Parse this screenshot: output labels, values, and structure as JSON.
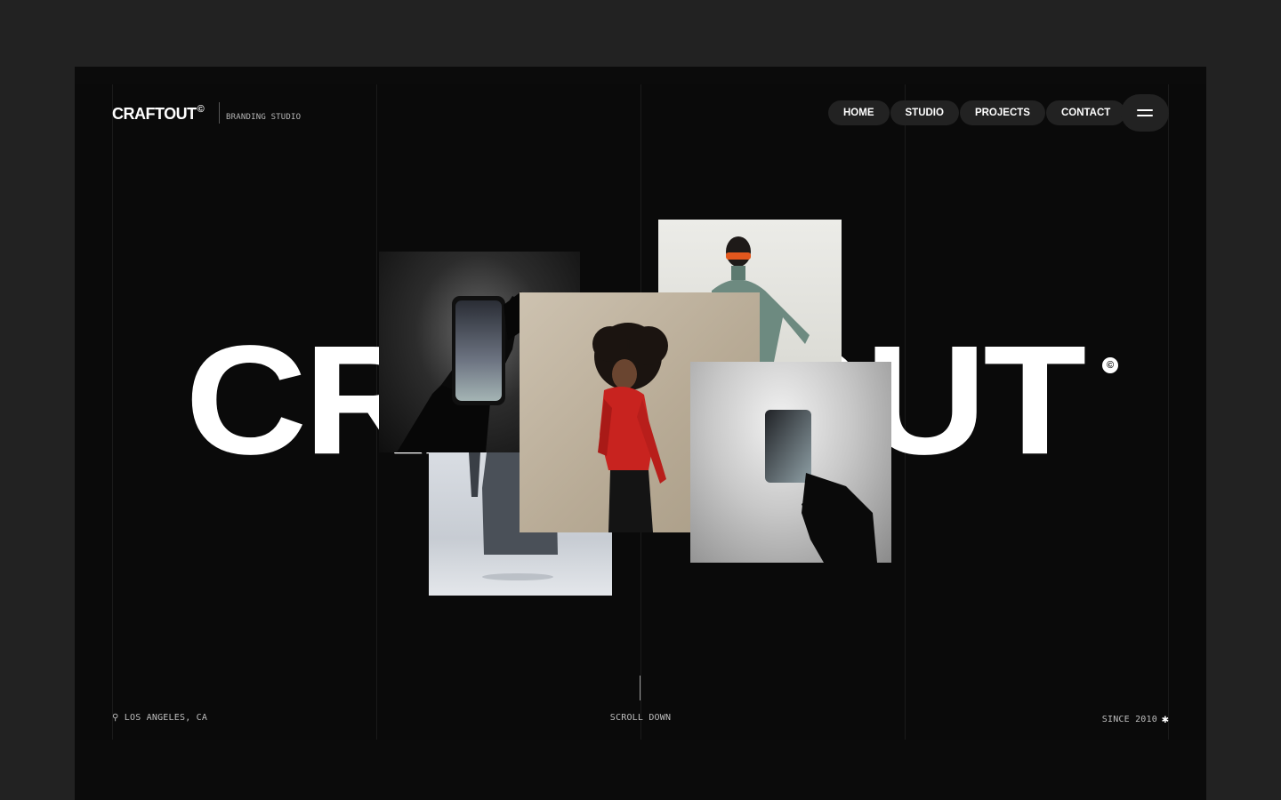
{
  "header": {
    "logo": "CRAFTOUT",
    "logo_mark": "©",
    "tagline": "BRANDING STUDIO"
  },
  "nav": {
    "items": [
      {
        "label": "HOME"
      },
      {
        "label": "STUDIO"
      },
      {
        "label": "PROJECTS"
      },
      {
        "label": "CONTACT"
      }
    ],
    "menu_icon": "hamburger-menu-icon"
  },
  "hero": {
    "wordmark": "CRAFTOUT",
    "wordmark_mark": "©",
    "images": [
      {
        "name": "hand-holding-phone-image"
      },
      {
        "name": "floating-tshirt-image"
      },
      {
        "name": "person-with-goggles-image"
      },
      {
        "name": "woman-red-jacket-image"
      },
      {
        "name": "hand-holding-card-image"
      }
    ]
  },
  "footer": {
    "location_icon": "location-pin-icon",
    "location": "LOS ANGELES, CA",
    "scroll": "SCROLL DOWN",
    "since": "SINCE 2010",
    "asterisk_icon": "asterisk-icon"
  },
  "colors": {
    "page_background": "#222222",
    "hero_background": "#0a0a0a",
    "text": "#ffffff",
    "pill": "#222222",
    "jacket_red": "#c8231f"
  }
}
